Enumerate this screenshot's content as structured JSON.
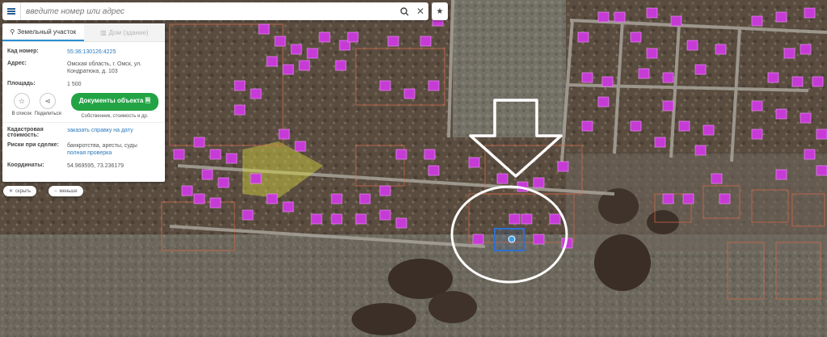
{
  "search": {
    "placeholder": "введите номер или адрес"
  },
  "icons": {
    "menu": "menu-icon",
    "search": "search-icon",
    "clear": "close-icon",
    "star": "star-icon"
  },
  "panel": {
    "tabs": [
      {
        "label": "Земельный участок"
      },
      {
        "label": "Дом (здание)"
      }
    ],
    "cadastral_number": {
      "label": "Кад номер:",
      "value": "55:36:130126:4225"
    },
    "address": {
      "label": "Адрес:",
      "value": "Омская область, г. Омск, ул. Кондратюка, д. 103"
    },
    "area": {
      "label": "Площадь:",
      "value": "1 500"
    },
    "actions": {
      "to_list": "В список",
      "share": "Поделиться",
      "documents": "Документы объекта",
      "documents_sub": "Собственник, стоимость и др."
    },
    "cad_value": {
      "label": "Кадастровая стоимость:",
      "value": "заказать справку на дату"
    },
    "risks": {
      "label": "Риски при сделке:",
      "value": "банкротства, аресты, суды",
      "link": "полная проверка"
    },
    "coords": {
      "label": "Координаты:",
      "value": "54.969595, 73.236179"
    }
  },
  "controls": {
    "hide": "скрыть",
    "less": "меньше"
  },
  "colors": {
    "accent": "#22a445",
    "house": "#c63bd6",
    "parcel": "#d86a4a",
    "highlight": "#2f6fd0"
  }
}
